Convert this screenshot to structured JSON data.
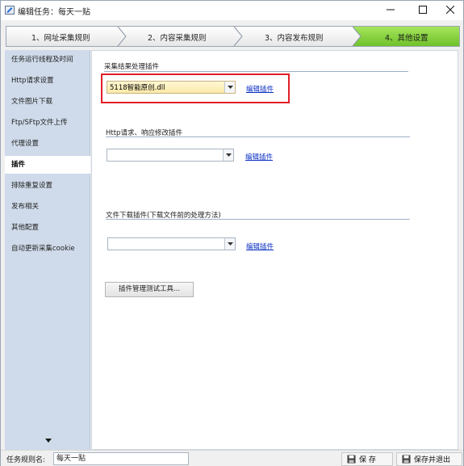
{
  "window": {
    "title": "编辑任务：每天一贴",
    "controls": {
      "minimize": "minimize-icon",
      "maximize": "maximize-icon",
      "close": "close-icon"
    }
  },
  "steps": [
    {
      "label": "1、网址采集规则"
    },
    {
      "label": "2、内容采集规则"
    },
    {
      "label": "3、内容发布规则"
    },
    {
      "label": "4、其他设置",
      "active": true
    }
  ],
  "sidebar": {
    "items": [
      {
        "label": "任务运行线程及时间"
      },
      {
        "label": "Http请求设置"
      },
      {
        "label": "文件图片下载"
      },
      {
        "label": "Ftp/SFtp文件上传"
      },
      {
        "label": "代理设置"
      },
      {
        "label": "插件",
        "selected": true
      },
      {
        "label": "排除重复设置"
      },
      {
        "label": "发布相关"
      },
      {
        "label": "其他配置"
      },
      {
        "label": "自动更新采集cookie"
      }
    ]
  },
  "main": {
    "collect_group": {
      "title": "采集结果处理插件",
      "value": "5118智能原创.dll",
      "link": "编辑插件"
    },
    "http_group": {
      "title": "Http请求、响应修改插件",
      "value": "",
      "link": "编辑插件"
    },
    "download_group": {
      "title": "文件下载插件(下载文件前的处理方法)",
      "value": "",
      "link": "编辑插件"
    },
    "tool_button": "插件管理测试工具..."
  },
  "footer": {
    "rule_name_label": "任务规则名:",
    "rule_name_value": "每天一贴",
    "save": "保 存",
    "save_exit": "保存并退出"
  },
  "colors": {
    "accent_step": "#86d23a",
    "sidebar_bg": "#cfdbea",
    "link": "#0a2fc4",
    "highlight": "#e21f26"
  }
}
